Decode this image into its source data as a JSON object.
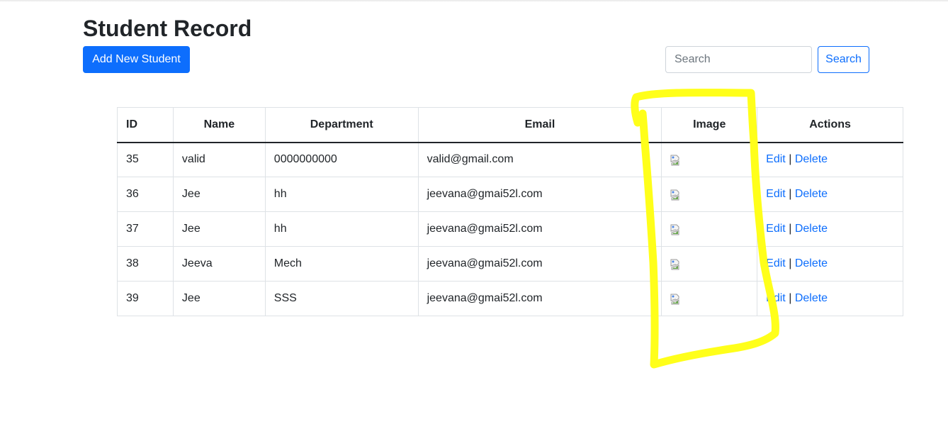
{
  "page": {
    "title": "Student Record",
    "add_button_label": "Add New Student",
    "search_placeholder": "Search",
    "search_value": "",
    "search_button_label": "Search"
  },
  "table": {
    "headers": [
      "ID",
      "Name",
      "Department",
      "Email",
      "Image",
      "Actions"
    ],
    "rows": [
      {
        "id": "35",
        "name": "valid",
        "department": "0000000000",
        "email": "valid@gmail.com"
      },
      {
        "id": "36",
        "name": "Jee",
        "department": "hh",
        "email": "jeevana@gmai52l.com"
      },
      {
        "id": "37",
        "name": "Jee",
        "department": "hh",
        "email": "jeevana@gmai52l.com"
      },
      {
        "id": "38",
        "name": "Jeeva",
        "department": "Mech",
        "email": "jeevana@gmai52l.com"
      },
      {
        "id": "39",
        "name": "Jee",
        "department": "SSS",
        "email": "jeevana@gmai52l.com"
      }
    ],
    "edit_label": "Edit",
    "separator": "|",
    "delete_label": "Delete"
  },
  "colors": {
    "primary": "#0d6efd",
    "highlight": "#ffff1a",
    "text": "#212529",
    "border": "#dee2e6"
  },
  "icons": {
    "image_cell": "broken-image-icon"
  }
}
